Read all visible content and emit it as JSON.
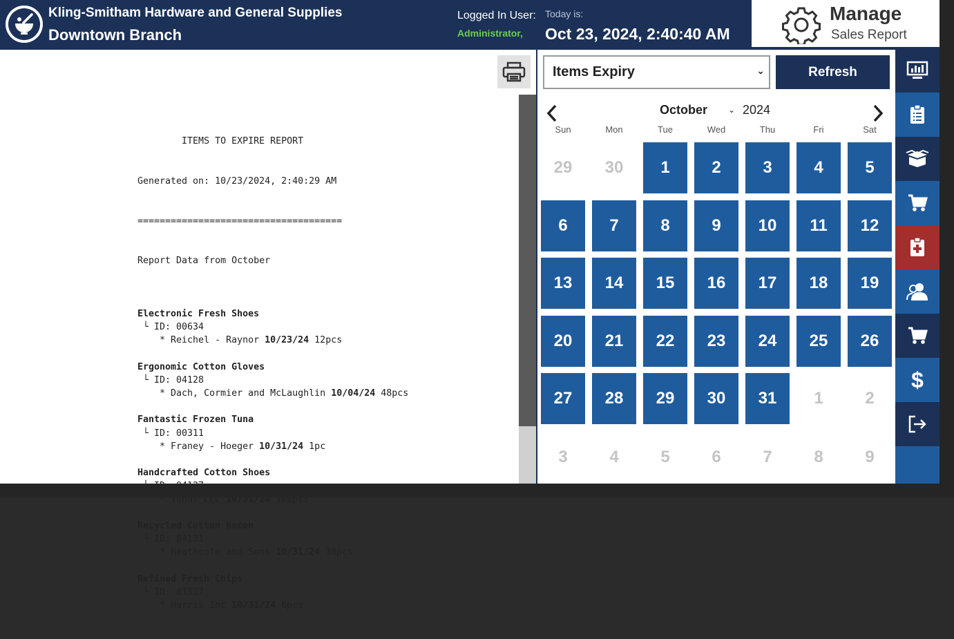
{
  "header": {
    "company": "Kling-Smitham Hardware and General Supplies",
    "branch": "Downtown Branch",
    "logged_label": "Logged In User:",
    "logged_user": "Administrator,",
    "today_label": "Today is:",
    "today_value": "Oct 23, 2024, 2:40:40 AM",
    "manage_title": "Manage",
    "manage_subtitle": "Sales Report"
  },
  "report": {
    "title": "        ITEMS TO EXPIRE REPORT",
    "generated": "Generated on: 10/23/2024, 2:40:29 AM",
    "separator": "=====================================",
    "data_from": "Report Data from October",
    "items": [
      {
        "name": "Electronic Fresh Shoes",
        "id": "00634",
        "supplier": "Reichel - Raynor",
        "date": "10/23/24",
        "qty": "12pcs"
      },
      {
        "name": "Ergonomic Cotton Gloves",
        "id": "04128",
        "supplier": "Dach, Cormier and McLaughlin",
        "date": "10/04/24",
        "qty": "48pcs"
      },
      {
        "name": "Fantastic Frozen Tuna",
        "id": "00311",
        "supplier": "Franey - Hoeger",
        "date": "10/31/24",
        "qty": "1pc"
      },
      {
        "name": "Handcrafted Cotton Shoes",
        "id": "04127",
        "supplier": "Yundt LLC",
        "date": "10/31/24",
        "qty": "100pcs"
      },
      {
        "name": "Recycled Cotton Bacon",
        "id": "04131",
        "supplier": "Heathcote and Sons",
        "date": "10/31/24",
        "qty": "30pcs"
      },
      {
        "name": "Refined Fresh Chips",
        "id": "01537",
        "supplier": "Harris Inc",
        "date": "10/31/24",
        "qty": "6pcs"
      }
    ]
  },
  "controls": {
    "report_type": "Items Expiry",
    "refresh_label": "Refresh"
  },
  "calendar": {
    "month": "October",
    "year": "2024",
    "weekdays": [
      "Sun",
      "Mon",
      "Tue",
      "Wed",
      "Thu",
      "Fri",
      "Sat"
    ],
    "weeks": [
      [
        {
          "d": "29",
          "c": false
        },
        {
          "d": "30",
          "c": false
        },
        {
          "d": "1",
          "c": true
        },
        {
          "d": "2",
          "c": true
        },
        {
          "d": "3",
          "c": true
        },
        {
          "d": "4",
          "c": true
        },
        {
          "d": "5",
          "c": true
        }
      ],
      [
        {
          "d": "6",
          "c": true
        },
        {
          "d": "7",
          "c": true
        },
        {
          "d": "8",
          "c": true
        },
        {
          "d": "9",
          "c": true
        },
        {
          "d": "10",
          "c": true
        },
        {
          "d": "11",
          "c": true
        },
        {
          "d": "12",
          "c": true
        }
      ],
      [
        {
          "d": "13",
          "c": true
        },
        {
          "d": "14",
          "c": true
        },
        {
          "d": "15",
          "c": true
        },
        {
          "d": "16",
          "c": true
        },
        {
          "d": "17",
          "c": true
        },
        {
          "d": "18",
          "c": true
        },
        {
          "d": "19",
          "c": true
        }
      ],
      [
        {
          "d": "20",
          "c": true
        },
        {
          "d": "21",
          "c": true
        },
        {
          "d": "22",
          "c": true
        },
        {
          "d": "23",
          "c": true
        },
        {
          "d": "24",
          "c": true
        },
        {
          "d": "25",
          "c": true
        },
        {
          "d": "26",
          "c": true
        }
      ],
      [
        {
          "d": "27",
          "c": true
        },
        {
          "d": "28",
          "c": true
        },
        {
          "d": "29",
          "c": true
        },
        {
          "d": "30",
          "c": true
        },
        {
          "d": "31",
          "c": true
        },
        {
          "d": "1",
          "c": false
        },
        {
          "d": "2",
          "c": false
        }
      ],
      [
        {
          "d": "3",
          "c": false
        },
        {
          "d": "4",
          "c": false
        },
        {
          "d": "5",
          "c": false
        },
        {
          "d": "6",
          "c": false
        },
        {
          "d": "7",
          "c": false
        },
        {
          "d": "8",
          "c": false
        },
        {
          "d": "9",
          "c": false
        }
      ]
    ]
  },
  "sidebar": {
    "items": [
      {
        "icon": "dashboard-monitor-icon",
        "style": "dark"
      },
      {
        "icon": "clipboard-list-icon",
        "style": "blue"
      },
      {
        "icon": "open-box-icon",
        "style": "dark"
      },
      {
        "icon": "shopping-cart-icon",
        "style": "blue"
      },
      {
        "icon": "medical-clipboard-icon",
        "style": "red"
      },
      {
        "icon": "users-icon",
        "style": "blue"
      },
      {
        "icon": "cart-icon",
        "style": "dark"
      },
      {
        "icon": "dollar-icon",
        "style": "blue"
      },
      {
        "icon": "logout-icon",
        "style": "dark"
      }
    ]
  },
  "colors": {
    "header_bg": "#1c3157",
    "calendar_day": "#1f5c9e",
    "active_red": "#a32e2e",
    "user_green": "#6ccf4f"
  }
}
